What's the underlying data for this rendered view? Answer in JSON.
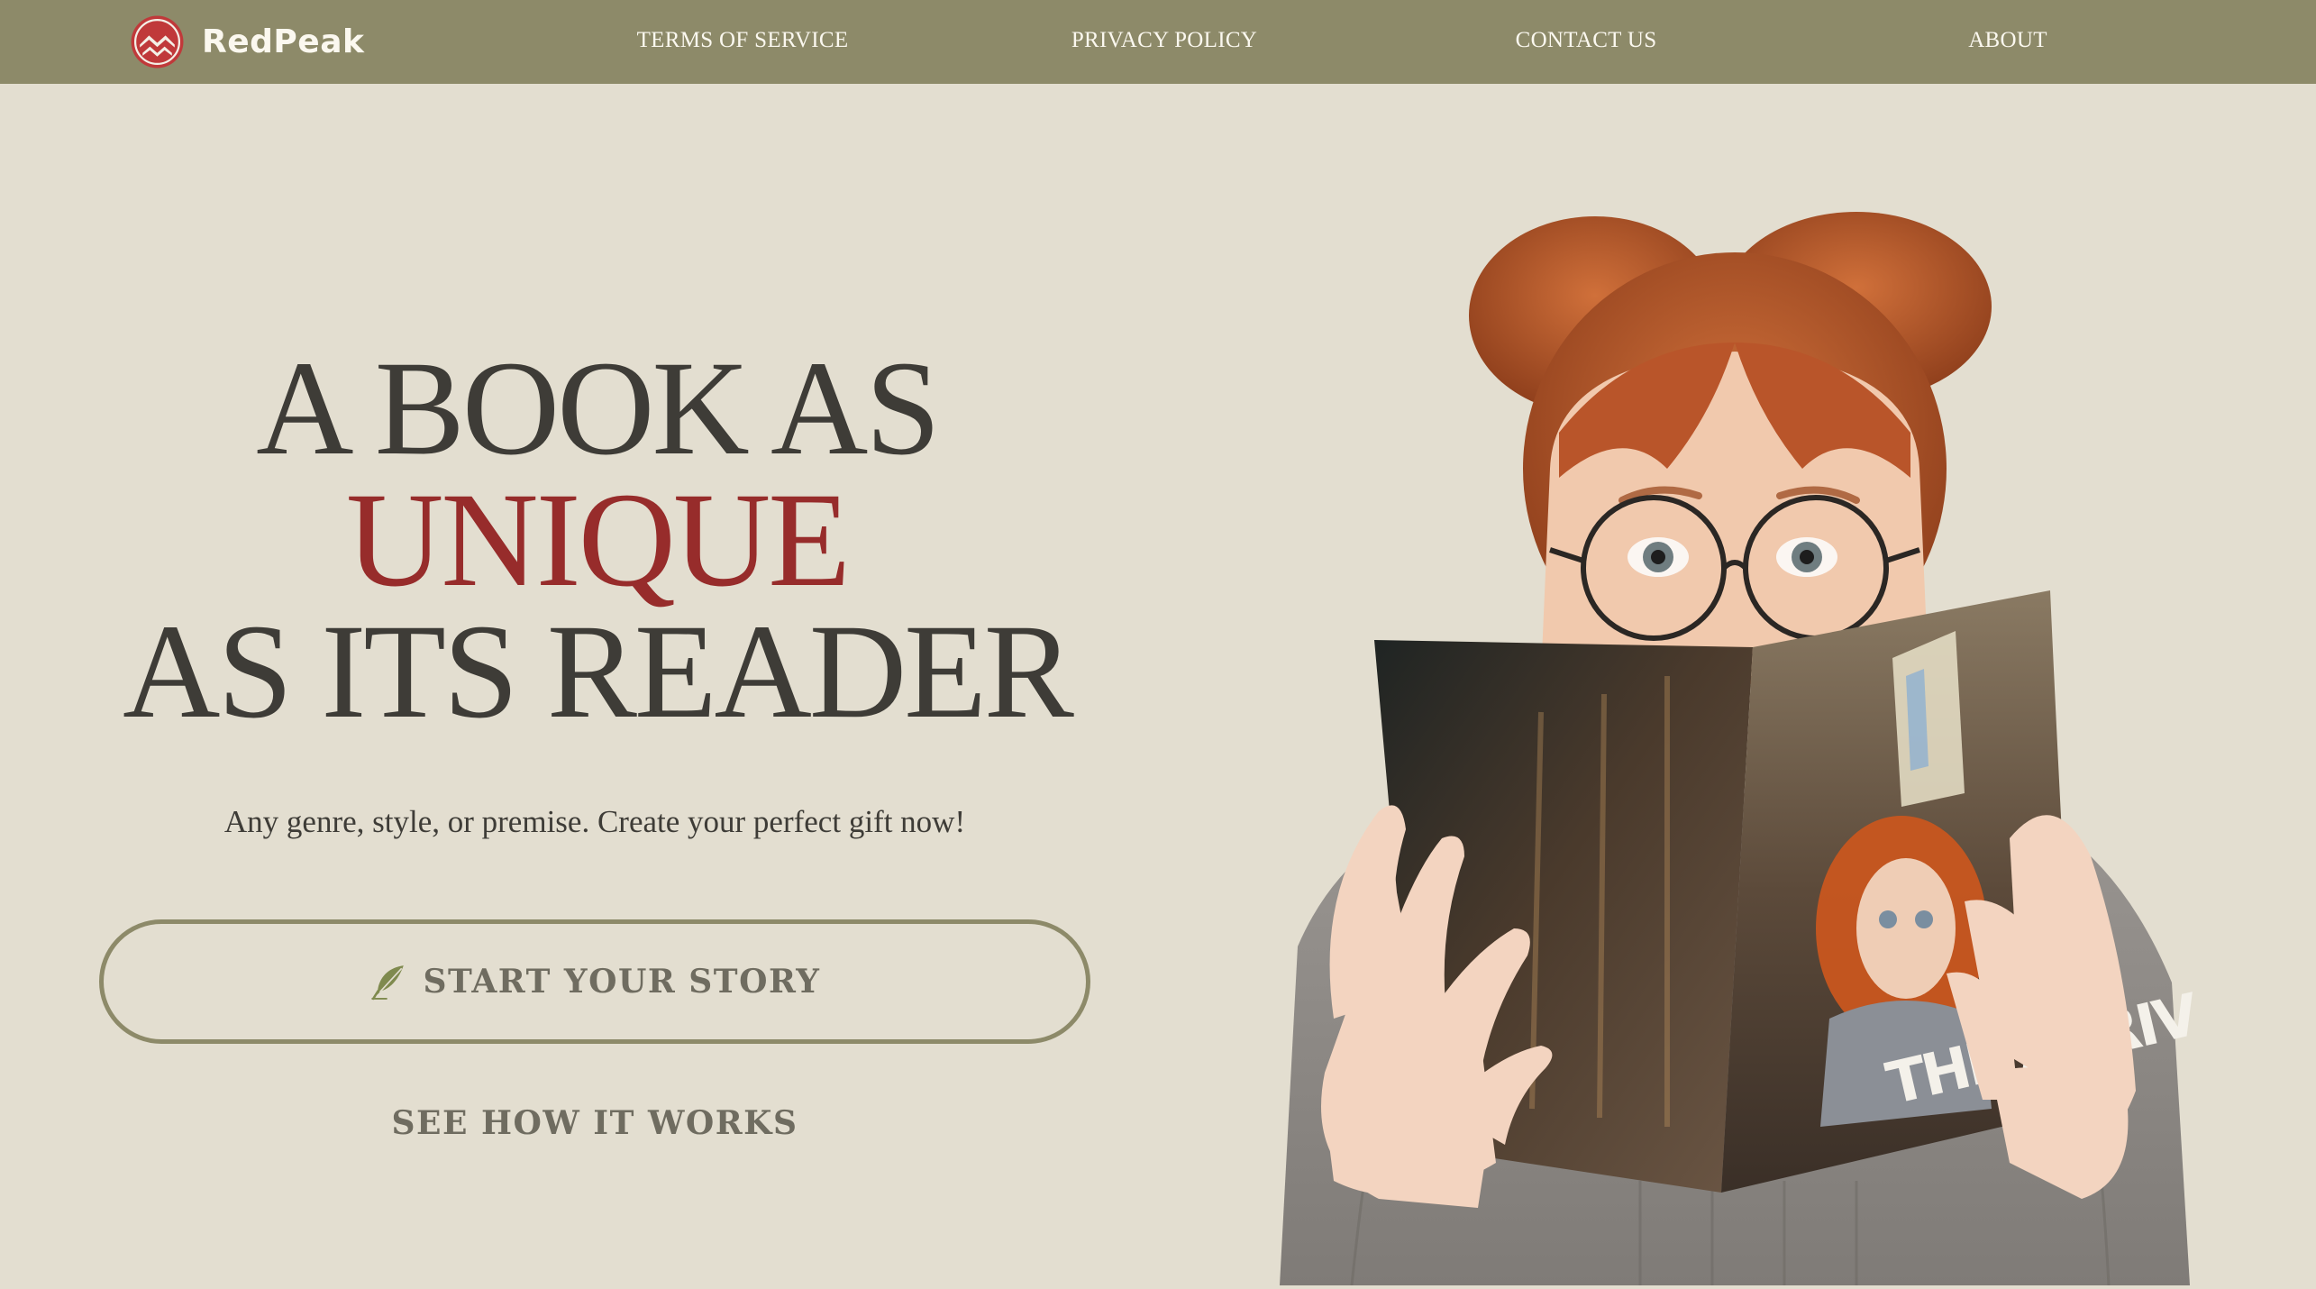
{
  "brand": {
    "name": "RedPeak",
    "logo_icon": "mountain-peak-icon",
    "logo_color": "#c0393a"
  },
  "nav": {
    "items": [
      {
        "label": "TERMS OF SERVICE"
      },
      {
        "label": "PRIVACY POLICY"
      },
      {
        "label": "CONTACT US"
      },
      {
        "label": "ABOUT"
      }
    ]
  },
  "hero": {
    "headline_line1": "A BOOK AS",
    "headline_accent": "UNIQUE",
    "headline_line3": "AS ITS READER",
    "subtext": "Any genre, style, or premise. Create your perfect gift now!",
    "cta_label": "START YOUR STORY",
    "cta_icon": "feather-quill-icon",
    "secondary_label": "SEE HOW IT WORKS",
    "book_cover_title": "THE ARRIV"
  },
  "colors": {
    "header_bg": "#8d8a69",
    "page_bg": "#e3ded0",
    "text": "#3e3c37",
    "accent": "#972c2b"
  }
}
